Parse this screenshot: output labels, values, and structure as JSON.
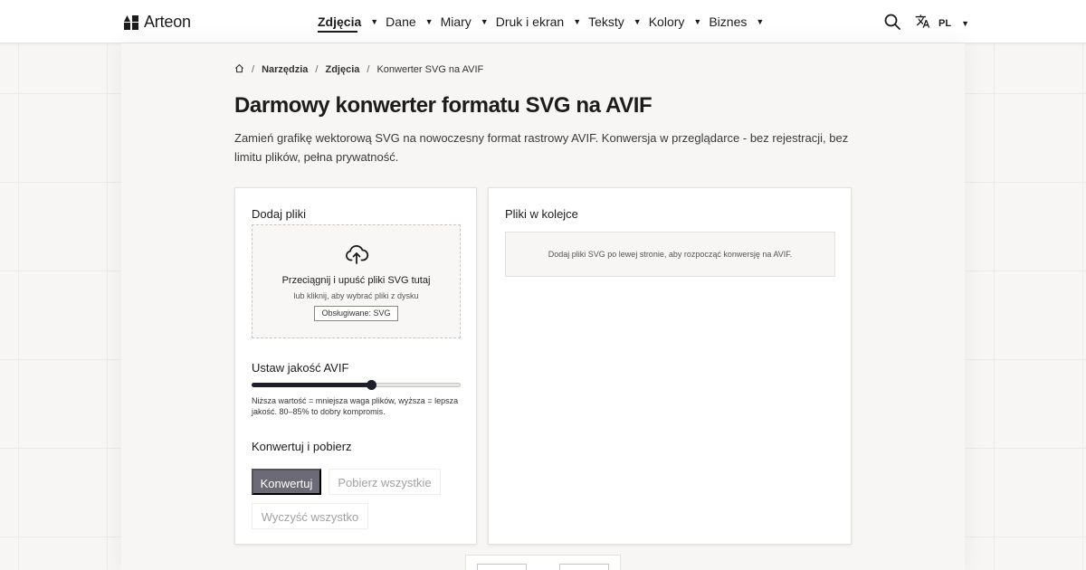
{
  "brand": {
    "name": "Arteon"
  },
  "nav": {
    "items": [
      {
        "label": "Zdjęcia",
        "active": true
      },
      {
        "label": "Dane",
        "active": false
      },
      {
        "label": "Miary",
        "active": false
      },
      {
        "label": "Druk i ekran",
        "active": false
      },
      {
        "label": "Teksty",
        "active": false
      },
      {
        "label": "Kolory",
        "active": false
      },
      {
        "label": "Biznes",
        "active": false
      }
    ],
    "caret": "▼",
    "language": "PL",
    "search_icon": "search-icon",
    "translate_icon": "translate-icon"
  },
  "breadcrumb": {
    "home_icon": "home-icon",
    "separator": "/",
    "items": [
      "Narzędzia",
      "Zdjęcia",
      "Konwerter SVG na AVIF"
    ]
  },
  "page": {
    "title": "Darmowy konwerter formatu SVG na AVIF",
    "description": "Zamień grafikę wektorową SVG na nowoczesny format rastrowy AVIF. Konwersja w przeglądarce - bez rejestracji, bez limitu plików, pełna prywatność."
  },
  "upload": {
    "section_title": "Dodaj pliki",
    "icon": "cloud-upload-icon",
    "main_text": "Przeciągnij i upuść pliki SVG tutaj",
    "sub_text": "lub kliknij, aby wybrać pliki z dysku",
    "badge": "Obsługiwane: SVG"
  },
  "quality": {
    "section_title": "Ustaw jakość AVIF",
    "value_fraction": 0.57,
    "hint": "Niższa wartość = mniejsza waga plików, wyższa = lepsza jakość. 80–85% to dobry kompromis."
  },
  "actions": {
    "section_title": "Konwertuj i pobierz",
    "convert": "Konwertuj",
    "download_all": "Pobierz wszystkie",
    "clear_all": "Wyczyść wszystko"
  },
  "queue": {
    "section_title": "Pliki w kolejce",
    "empty_text": "Dodaj pliki SVG po lewej stronie, aby rozpocząć konwersję na AVIF."
  },
  "colors": {
    "primary_button": "#6b6a76",
    "slider_fill": "#1e1e2c",
    "background": "#f7f6f4"
  }
}
